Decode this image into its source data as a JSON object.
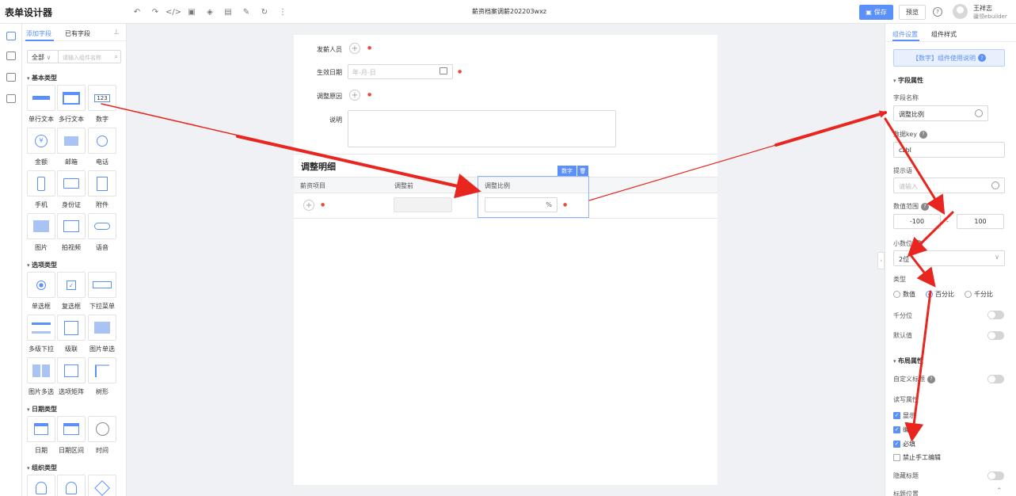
{
  "app_title": "表单设计器",
  "document_title": "薪资档案调薪202203wxz",
  "header": {
    "save_label": "保存",
    "preview_label": "预览",
    "user_name": "王祥志",
    "user_org": "疆领ebuilder"
  },
  "left_panel": {
    "tabs": [
      "添加字段",
      "已有字段"
    ],
    "category_select": "全部",
    "search_placeholder": "请输入组件名称",
    "sections": [
      {
        "title": "基本类型",
        "items": [
          "单行文本",
          "多行文本",
          "数字",
          "金额",
          "邮箱",
          "电话",
          "手机",
          "身份证",
          "附件",
          "图片",
          "拍视频",
          "语音"
        ]
      },
      {
        "title": "选项类型",
        "items": [
          "单选框",
          "复选框",
          "下拉菜单",
          "多级下拉",
          "级联",
          "图片单选",
          "图片多选",
          "选项矩阵",
          "树形"
        ]
      },
      {
        "title": "日期类型",
        "items": [
          "日期",
          "日期区间",
          "时间"
        ]
      },
      {
        "title": "组织类型",
        "items": []
      }
    ],
    "number_icon_text": "123"
  },
  "form": {
    "fields": [
      {
        "label": "发薪人员"
      },
      {
        "label": "生效日期",
        "placeholder": "年-月-日"
      },
      {
        "label": "调整原因"
      },
      {
        "label": "说明"
      }
    ],
    "detail": {
      "title": "调整明细",
      "columns": [
        "薪资项目",
        "调整前",
        "调整比例"
      ],
      "percent_suffix": "%",
      "selected_tag": "数字",
      "delete_icon": "trash-icon"
    }
  },
  "right_panel": {
    "tabs": [
      "组件设置",
      "组件样式"
    ],
    "banner": "【数字】组件使用说明",
    "sections": {
      "field_props": "字段属性",
      "layout_props": "布局属性"
    },
    "field_name_label": "字段名称",
    "field_name_value": "调整比例",
    "data_key_label": "数据key",
    "data_key_value": "czbl",
    "hint_label": "提示语",
    "hint_placeholder": "请输入",
    "range_label": "数值范围",
    "range_min": "-100",
    "range_sep": "-",
    "range_max": "100",
    "decimal_label": "小数位",
    "decimal_value": "2位",
    "type_label": "类型",
    "type_options": [
      "数值",
      "百分比",
      "千分比"
    ],
    "type_selected": "百分比",
    "thousands_label": "千分位",
    "default_label": "默认值",
    "custom_title_label": "自定义标题",
    "rw_label": "读写属性",
    "rw_options": [
      {
        "label": "显示",
        "checked": true
      },
      {
        "label": "编辑",
        "checked": true
      },
      {
        "label": "必填",
        "checked": true
      },
      {
        "label": "禁止手工编辑",
        "checked": false
      }
    ],
    "hide_title_label": "隐藏标题",
    "title_position_label": "标题位置"
  },
  "colors": {
    "accent": "#5b8ff9",
    "arrow": "#e8261f",
    "required": "#e74c3c"
  }
}
